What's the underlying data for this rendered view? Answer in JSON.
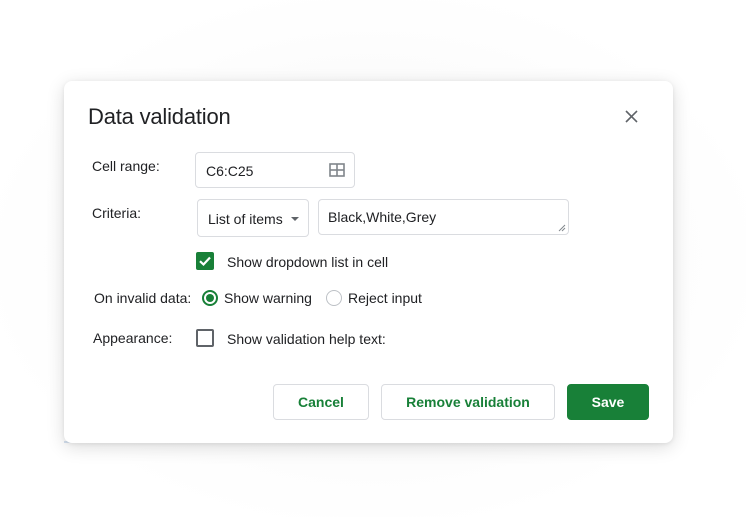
{
  "dialog": {
    "title": "Data validation",
    "close_icon": "close-icon"
  },
  "cell_range": {
    "label": "Cell range:",
    "value": "C6:C25",
    "icon": "grid-select-icon"
  },
  "criteria": {
    "label": "Criteria:",
    "type_selected": "List of items",
    "items_value": "Black,White,Grey"
  },
  "dropdown_option": {
    "label": "Show dropdown list in cell",
    "checked": true
  },
  "invalid_data": {
    "label": "On invalid data:",
    "options": [
      {
        "label": "Show warning",
        "selected": true
      },
      {
        "label": "Reject input",
        "selected": false
      }
    ]
  },
  "appearance": {
    "label": "Appearance:",
    "help_text_label": "Show validation help text:",
    "checked": false
  },
  "buttons": {
    "cancel": "Cancel",
    "remove": "Remove validation",
    "save": "Save"
  },
  "colors": {
    "accent": "#188038",
    "border": "#dadce0",
    "text": "#202124"
  }
}
